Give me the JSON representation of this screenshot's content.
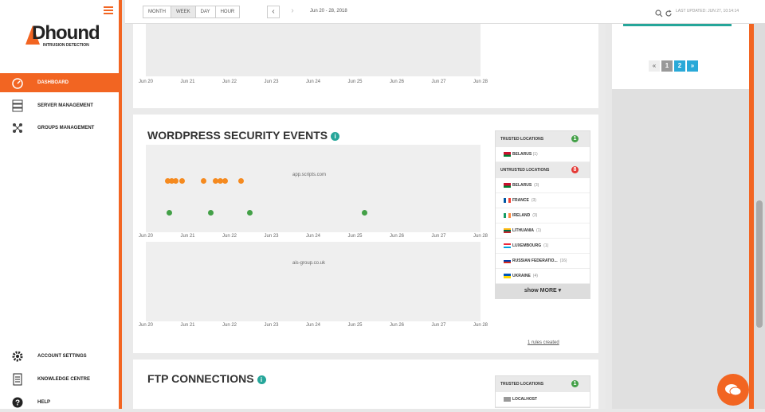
{
  "app": {
    "logo_text": "Dhound",
    "logo_tagline": "INTRUSION DETECTION"
  },
  "sidebar": {
    "items": [
      {
        "label": "DASHBOARD",
        "icon": "speedometer-icon",
        "active": true
      },
      {
        "label": "SERVER MANAGEMENT",
        "icon": "server-icon",
        "active": false
      },
      {
        "label": "GROUPS MANAGEMENT",
        "icon": "groups-icon",
        "active": false
      }
    ],
    "bottom_items": [
      {
        "label": "ACCOUNT SETTINGS",
        "icon": "gear-icon"
      },
      {
        "label": "KNOWLEDGE CENTRE",
        "icon": "document-icon"
      },
      {
        "label": "HELP",
        "icon": "question-icon"
      }
    ]
  },
  "toolbar": {
    "views": [
      "MONTH",
      "WEEK",
      "DAY",
      "HOUR"
    ],
    "active_view": "WEEK",
    "date_range": "Jun 20 - 28, 2018",
    "last_updated": "LAST UPDATED: JUN 27, 10:14:14"
  },
  "x_ticks": [
    "Jun 20",
    "Jun 21",
    "Jun 22",
    "Jun 23",
    "Jun 24",
    "Jun 25",
    "Jun 26",
    "Jun 27",
    "Jun 28"
  ],
  "wordpress": {
    "title": "WORDPRESS SECURITY EVENTS",
    "hosts": [
      "app.scripts.com",
      "ais-group.co.uk"
    ],
    "trusted_header": "TRUSTED LOCATIONS",
    "trusted_count": "1",
    "trusted": [
      {
        "name": "BELARUS",
        "count": "(1)"
      }
    ],
    "untrusted_header": "UNTRUSTED LOCATIONS",
    "untrusted_count": "8",
    "untrusted": [
      {
        "name": "BELARUS",
        "count": "(3)"
      },
      {
        "name": "FRANCE",
        "count": "(3)"
      },
      {
        "name": "IRELAND",
        "count": "(3)"
      },
      {
        "name": "LITHUANIA",
        "count": "(1)"
      },
      {
        "name": "LUXEMBOURG",
        "count": "(1)"
      },
      {
        "name": "RUSSIAN FEDERATIO...",
        "count": "(16)"
      },
      {
        "name": "UKRAINE",
        "count": "(4)"
      }
    ],
    "show_more": "show MORE ▾",
    "rules_link": "1 rules created"
  },
  "ftp": {
    "title": "FTP CONNECTIONS",
    "trusted_header": "TRUSTED LOCATIONS",
    "trusted_count": "1",
    "trusted": [
      {
        "name": "LOCALHOST",
        "count": ""
      }
    ]
  },
  "pagination": {
    "prev": "«",
    "pages": [
      "1",
      "2"
    ],
    "next": "»"
  },
  "colors": {
    "accent": "#f26522",
    "teal": "#26a69a",
    "orange_dot": "#f58a1f",
    "green_dot": "#43a047"
  }
}
